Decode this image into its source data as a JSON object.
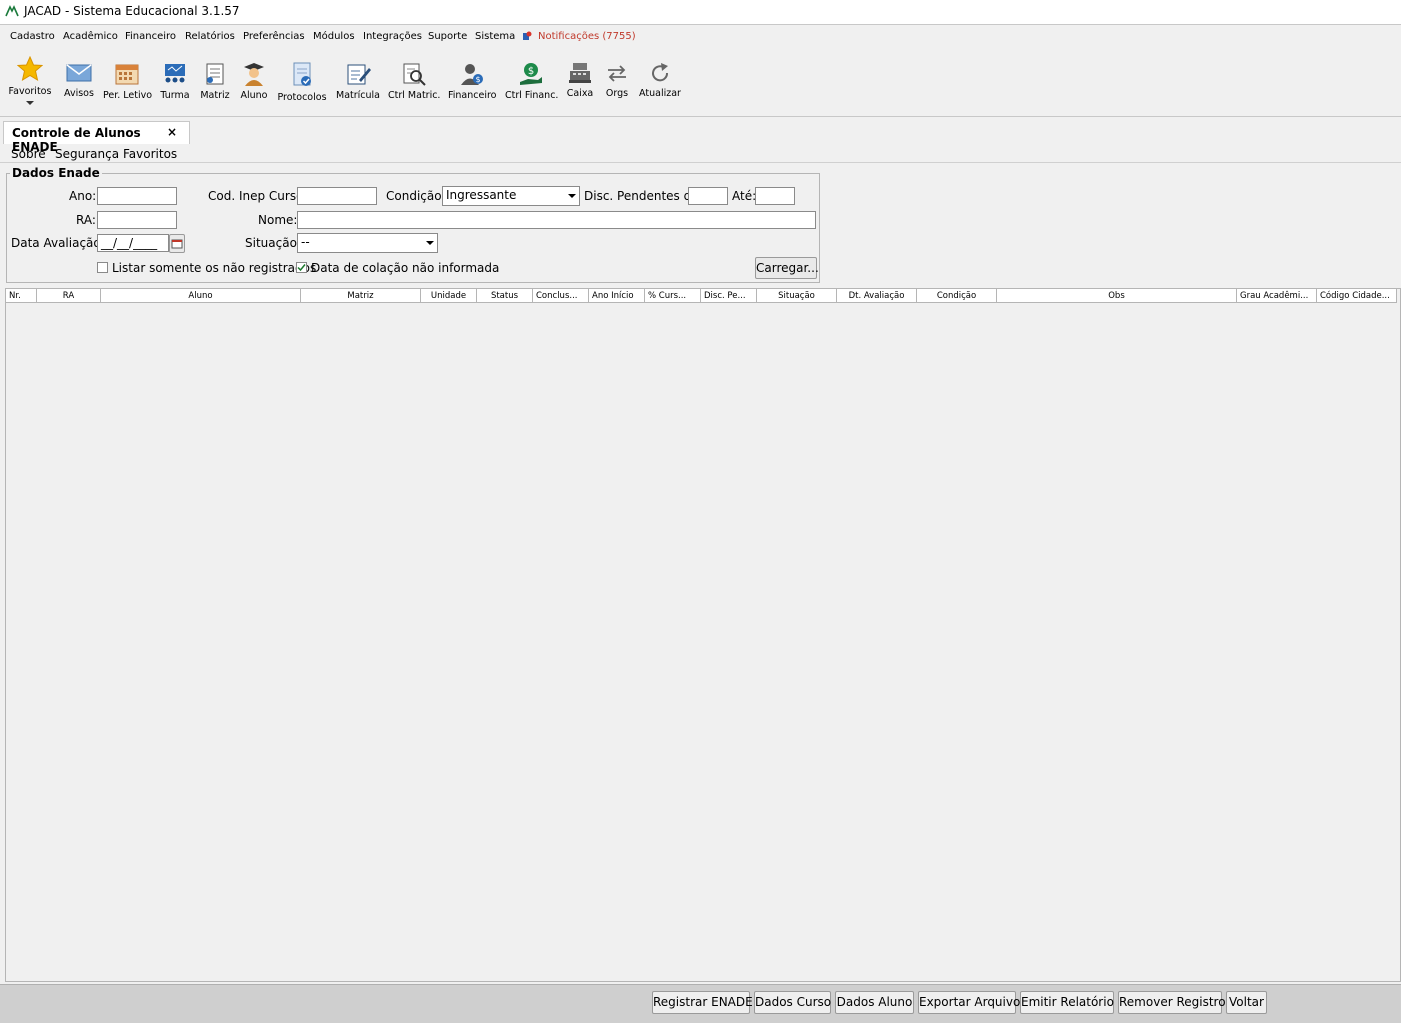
{
  "window": {
    "title": "JACAD - Sistema Educacional 3.1.57"
  },
  "menubar": {
    "items": [
      "Cadastro",
      "Acadêmico",
      "Financeiro",
      "Relatórios",
      "Preferências",
      "Módulos",
      "Integrações",
      "Suporte",
      "Sistema"
    ],
    "notifications": "Notificações (7755)"
  },
  "toolbar": {
    "items": [
      "Favoritos",
      "Avisos",
      "Per. Letivo",
      "Turma",
      "Matriz",
      "Aluno",
      "Protocolos",
      "Matrícula",
      "Ctrl Matric.",
      "Financeiro",
      "Ctrl Financ.",
      "Caixa",
      "Orgs",
      "Atualizar"
    ]
  },
  "tab": {
    "title": "Controle de Alunos ENADE",
    "close": "×"
  },
  "inner_menu": [
    "Sobre",
    "Segurança",
    "Favoritos"
  ],
  "form": {
    "legend": "Dados Enade",
    "ano_label": "Ano:",
    "cod_inep_label": "Cod. Inep Curso:",
    "condicao_label": "Condição:",
    "condicao_value": "Ingressante",
    "disc_pend_label": "Disc. Pendentes de:",
    "ate_label": "Até:",
    "ra_label": "RA:",
    "nome_label": "Nome:",
    "data_aval_label": "Data Avaliação:",
    "data_aval_value": "__/__/____",
    "situacao_label": "Situação:",
    "situacao_value": "--",
    "chk_nao_registrados": "Listar somente os não registrados",
    "chk_colacao": "Data de colação não informada",
    "carregar": "Carregar..."
  },
  "table": {
    "columns": [
      "Nr.",
      "RA",
      "Aluno",
      "Matriz",
      "Unidade",
      "Status",
      "Conclus...",
      "Ano Início",
      "% Curs...",
      "Disc. Pe...",
      "Situação",
      "Dt. Avaliação",
      "Condição",
      "Obs",
      "Grau Acadêmi...",
      "Código Cidade..."
    ]
  },
  "bottom_buttons": [
    "Registrar ENADE",
    "Dados Curso",
    "Dados Aluno",
    "Exportar Arquivo",
    "Emitir Relatório",
    "Remover Registro",
    "Voltar"
  ]
}
